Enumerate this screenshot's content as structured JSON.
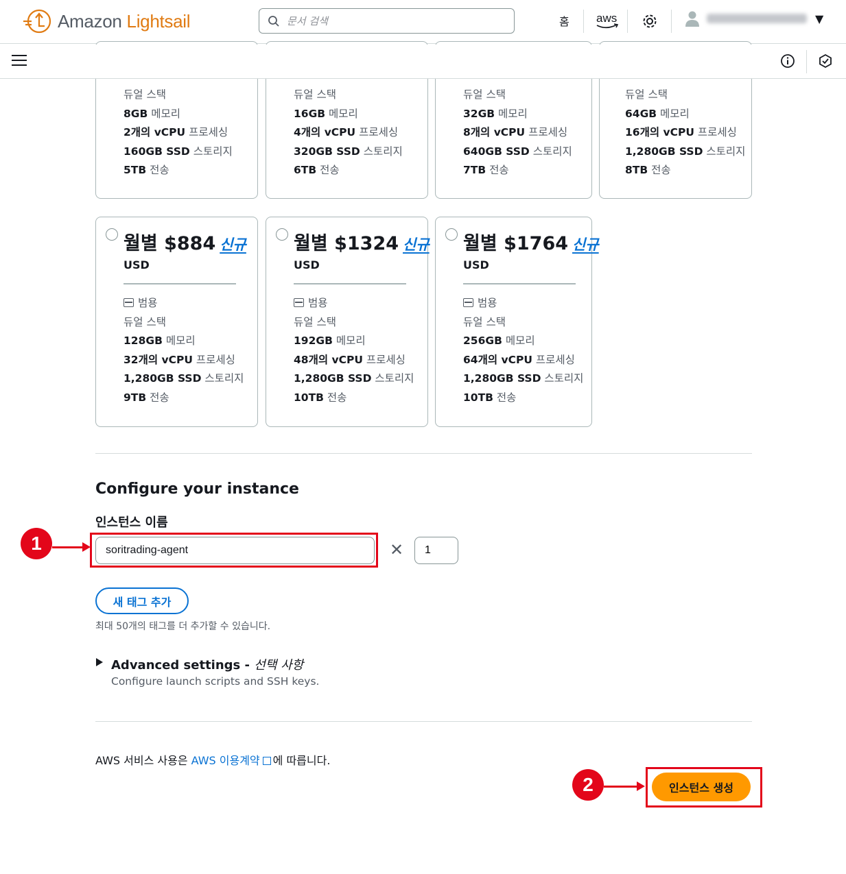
{
  "header": {
    "logo_text_1": "Amazon",
    "logo_text_2": "Lightsail",
    "search_placeholder": "문서 검색",
    "home": "홈",
    "aws_label": "aws"
  },
  "top_cards": [
    {
      "category": "듀얼 스택",
      "memory": "8GB",
      "memory_label": " 메모리",
      "vcpu": "2개의 vCPU",
      "vcpu_label": " 프로세싱",
      "ssd": "160GB SSD",
      "ssd_label": " 스토리지",
      "transfer": "5TB",
      "transfer_label": " 전송"
    },
    {
      "category": "듀얼 스택",
      "memory": "16GB",
      "memory_label": " 메모리",
      "vcpu": "4개의 vCPU",
      "vcpu_label": " 프로세싱",
      "ssd": "320GB SSD",
      "ssd_label": " 스토리지",
      "transfer": "6TB",
      "transfer_label": " 전송"
    },
    {
      "category": "듀얼 스택",
      "memory": "32GB",
      "memory_label": " 메모리",
      "vcpu": "8개의 vCPU",
      "vcpu_label": " 프로세싱",
      "ssd": "640GB SSD",
      "ssd_label": " 스토리지",
      "transfer": "7TB",
      "transfer_label": " 전송"
    },
    {
      "category": "듀얼 스택",
      "memory": "64GB",
      "memory_label": " 메모리",
      "vcpu": "16개의 vCPU",
      "vcpu_label": " 프로세싱",
      "ssd": "1,280GB SSD",
      "ssd_label": " 스토리지",
      "transfer": "8TB",
      "transfer_label": " 전송"
    }
  ],
  "plans": [
    {
      "price": "월별 $884",
      "new": "신규",
      "currency": "USD",
      "type": "범용",
      "category": "듀얼 스택",
      "memory": "128GB",
      "memory_label": " 메모리",
      "vcpu": "32개의 vCPU",
      "vcpu_label": " 프로세싱",
      "ssd": "1,280GB SSD",
      "ssd_label": " 스토리지",
      "transfer": "9TB",
      "transfer_label": " 전송"
    },
    {
      "price": "월별 $1324",
      "new": "신규",
      "currency": "USD",
      "type": "범용",
      "category": "듀얼 스택",
      "memory": "192GB",
      "memory_label": " 메모리",
      "vcpu": "48개의 vCPU",
      "vcpu_label": " 프로세싱",
      "ssd": "1,280GB SSD",
      "ssd_label": " 스토리지",
      "transfer": "10TB",
      "transfer_label": " 전송"
    },
    {
      "price": "월별 $1764",
      "new": "신규",
      "currency": "USD",
      "type": "범용",
      "category": "듀얼 스택",
      "memory": "256GB",
      "memory_label": " 메모리",
      "vcpu": "64개의 vCPU",
      "vcpu_label": " 프로세싱",
      "ssd": "1,280GB SSD",
      "ssd_label": " 스토리지",
      "transfer": "10TB",
      "transfer_label": " 전송"
    }
  ],
  "configure": {
    "title": "Configure your instance",
    "name_label": "인스턴스 이름",
    "name_value": "soritrading-agent",
    "times": "✕",
    "quantity": "1",
    "tag_button": "새 태그 추가",
    "tag_hint": "최대 50개의 태그를 더 추가할 수 있습니다.",
    "advanced_title": "Advanced settings - ",
    "advanced_optional": "선택 사항",
    "advanced_desc": "Configure launch scripts and SSH keys."
  },
  "footer": {
    "terms_prefix": "AWS 서비스 사용은 ",
    "terms_link": "AWS 이용계약",
    "terms_suffix": "에 따릅니다.",
    "create_button": "인스턴스 생성"
  },
  "annotations": {
    "badge_1": "1",
    "badge_2": "2",
    "color": "#e3061a"
  },
  "colors": {
    "brand_orange": "#ff9900",
    "link_blue": "#0972d3"
  }
}
